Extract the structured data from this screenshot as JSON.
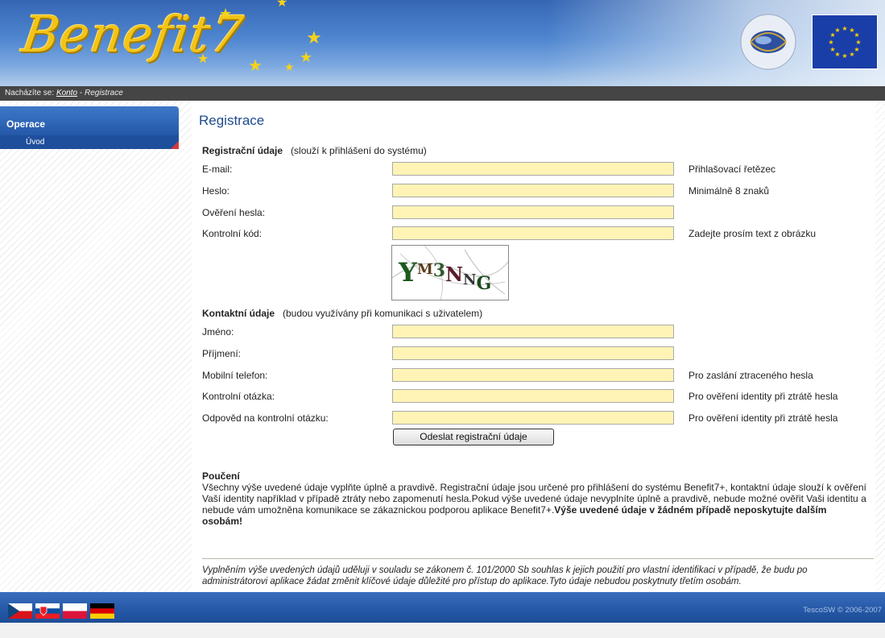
{
  "header": {
    "logo_text": "Benefit7"
  },
  "breadcrumb": {
    "prefix": "Nacházíte se:",
    "link": "Konto",
    "separator": " - ",
    "current": "Registrace"
  },
  "sidebar": {
    "section_title": "Operace",
    "items": [
      {
        "label": "Úvod"
      }
    ]
  },
  "page": {
    "title": "Registrace"
  },
  "registration": {
    "heading": "Registrační údaje",
    "subheading": "(slouží k přihlášení do systému)",
    "fields": [
      {
        "label": "E-mail:",
        "value": "",
        "hint": "Přihlašovací řetězec"
      },
      {
        "label": "Heslo:",
        "value": "",
        "hint": "Minimálně 8 znaků"
      },
      {
        "label": "Ověření hesla:",
        "value": "",
        "hint": ""
      },
      {
        "label": "Kontrolní kód:",
        "value": "",
        "hint": "Zadejte prosím text z obrázku"
      }
    ],
    "captcha_text": "YM3NNG"
  },
  "contact": {
    "heading": "Kontaktní údaje",
    "subheading": "(budou využívány při komunikaci s uživatelem)",
    "fields": [
      {
        "label": "Jméno:",
        "value": "",
        "hint": ""
      },
      {
        "label": "Příjmení:",
        "value": "",
        "hint": ""
      },
      {
        "label": "Mobilní telefon:",
        "value": "",
        "hint": "Pro zaslání ztraceného hesla"
      },
      {
        "label": "Kontrolní otázka:",
        "value": "",
        "hint": "Pro ověření identity při ztrátě hesla"
      },
      {
        "label": "Odpověd na kontrolní otázku:",
        "value": "",
        "hint": "Pro ověření identity při ztrátě hesla"
      }
    ]
  },
  "submit_label": "Odeslat registrační údaje",
  "notice": {
    "title": "Poučení",
    "body": "Všechny výše uvedené údaje vyplňte úplně a pravdivě. Registrační údaje jsou určené pro přihlášení do systému Benefit7+, kontaktní údaje slouží k ověření Vaší identity například v případě ztráty nebo zapomenutí hesla.Pokud výše uvedené údaje nevyplníte úplně a pravdivě, nebude možné ověřit Vaši identitu a nebude vám umožněna komunikace se zákaznickou podporou aplikace Benefit7+.",
    "bold": "Výše uvedené údaje v žádném případě neposkytujte dalším osobám!"
  },
  "footnote": "Vyplněním výše uvedených údajů uděluji v souladu se zákonem č. 101/2000 Sb souhlas k jejich použití pro vlastní identifikaci v případě, že budu po administrátorovi aplikace žádat změnit klíčové údaje důležité pro přístup do aplikace.Tyto údaje nebudou poskytnuty třetím osobám.",
  "footer": {
    "copyright": "TescoSW © 2006-2007",
    "languages": [
      "cs-flag-icon",
      "sk-flag-icon",
      "pl-flag-icon",
      "de-flag-icon"
    ]
  },
  "colors": {
    "field_bg": "#fff4b6",
    "header_blue": "#2458a8",
    "title_blue": "#1f4a8f"
  }
}
